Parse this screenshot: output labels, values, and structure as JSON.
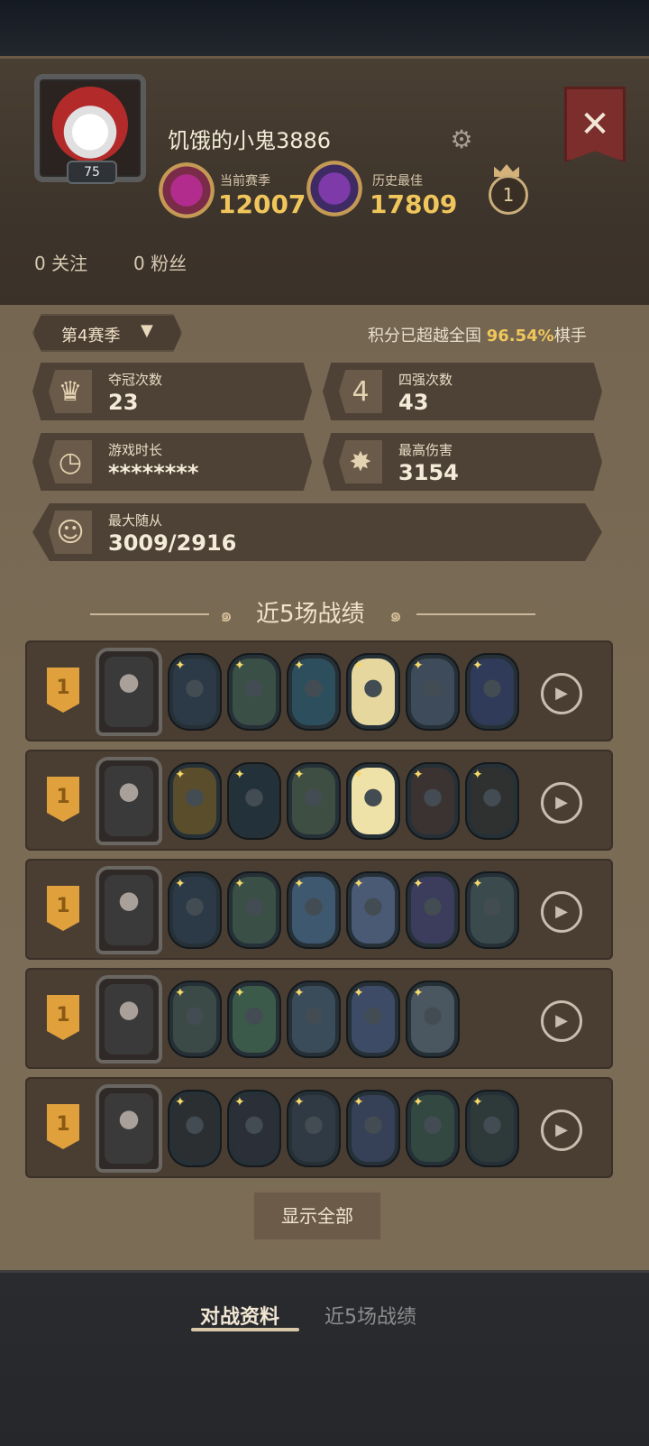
{
  "header": {
    "player_name": "饥饿的小鬼3886",
    "level": "75",
    "current_season_label": "当前赛季",
    "current_season_score": "12007",
    "best_label": "历史最佳",
    "best_score": "17809",
    "rank_medal": "1",
    "follow_count": "0 关注",
    "fans_count": "0 粉丝",
    "close_label": "✕",
    "gear_icon": "gear-icon"
  },
  "season_select": {
    "label": "第4赛季",
    "caret": "▼"
  },
  "rank_info": {
    "prefix": "积分已超越全国 ",
    "percent": "96.54%",
    "suffix": "棋手"
  },
  "stats": [
    {
      "title": "夺冠次数",
      "value": "23",
      "icon": "♛"
    },
    {
      "title": "四强次数",
      "value": "43",
      "icon": "4"
    },
    {
      "title": "游戏时长",
      "value": "********",
      "icon": "◷"
    },
    {
      "title": "最高伤害",
      "value": "3154",
      "icon": "✸"
    },
    {
      "title": "最大随从",
      "value": "3009/2916",
      "icon": "☺"
    }
  ],
  "recent_title": "近5场战绩",
  "matches": [
    {
      "place": "1",
      "hero": "hero-1",
      "units": [
        "#2b3a46",
        "#3a4f46",
        "#2d4f5d",
        "#e6d79f",
        "#3d4b5a",
        "#2f3b59"
      ]
    },
    {
      "place": "1",
      "hero": "hero-2",
      "units": [
        "#5a4d2c",
        "#23323a",
        "#3f4e42",
        "#efe2a9",
        "#3b3232",
        "#2f3030"
      ]
    },
    {
      "place": "1",
      "hero": "hero-3",
      "units": [
        "#2b3a46",
        "#3a4f46",
        "#3e5870",
        "#4a5a74",
        "#3c3c5d",
        "#3b4a4c"
      ]
    },
    {
      "place": "1",
      "hero": "hero-4",
      "units": [
        "#3b4a46",
        "#3c5a4a",
        "#3a4b5a",
        "#3d4b66",
        "#4a5660"
      ]
    },
    {
      "place": "1",
      "hero": "hero-5",
      "units": [
        "#2b2f31",
        "#2b2f37",
        "#2f3a44",
        "#364057",
        "#324841",
        "#2e3a3a"
      ]
    }
  ],
  "show_all_label": "显示全部",
  "tabs": {
    "active": "对战资料",
    "inactive": "近5场战绩"
  },
  "colors": {
    "accent_gold": "#f0c65c",
    "panel_brown": "#746651"
  }
}
